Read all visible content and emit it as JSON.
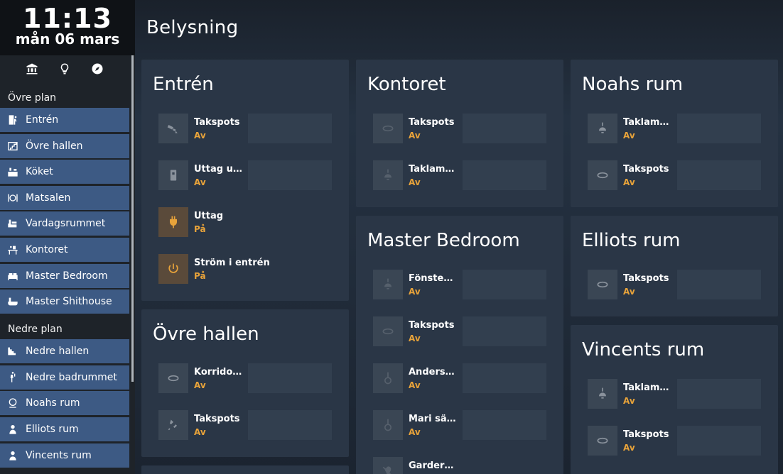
{
  "clock": {
    "time": "11:13",
    "date": "mån 06 mars"
  },
  "quick_icons": [
    "bank-icon",
    "lightbulb-outline-icon",
    "compass-icon"
  ],
  "sidebar": {
    "sections": [
      {
        "label": "Övre plan",
        "items": [
          {
            "label": "Entrén",
            "icon": "door-walk-icon"
          },
          {
            "label": "Övre hallen",
            "icon": "stairs-icon"
          },
          {
            "label": "Köket",
            "icon": "kitchen-icon"
          },
          {
            "label": "Matsalen",
            "icon": "dining-icon"
          },
          {
            "label": "Vardagsrummet",
            "icon": "sofa-icon"
          },
          {
            "label": "Kontoret",
            "icon": "desk-icon"
          },
          {
            "label": "Master Bedroom",
            "icon": "bed-icon"
          },
          {
            "label": "Master Shithouse",
            "icon": "bathtub-icon"
          }
        ]
      },
      {
        "label": "Nedre plan",
        "items": [
          {
            "label": "Nedre hallen",
            "icon": "stairs-down-icon"
          },
          {
            "label": "Nedre badrummet",
            "icon": "shower-icon"
          },
          {
            "label": "Noahs rum",
            "icon": "face-icon"
          },
          {
            "label": "Elliots rum",
            "icon": "child-icon"
          },
          {
            "label": "Vincents rum",
            "icon": "person-icon"
          }
        ]
      }
    ]
  },
  "page_title": "Belysning",
  "cards": [
    {
      "title": "Entrén",
      "entities": [
        {
          "name": "Takspots",
          "state": "Av",
          "icon": "spotlight-icon",
          "on": false
        },
        {
          "name": "Uttag ute",
          "state": "Av",
          "icon": "outlet-icon",
          "on": false
        },
        {
          "name": "Uttag",
          "state": "På",
          "icon": "plug-icon",
          "on": true
        },
        {
          "name": "Ström i entrén",
          "state": "På",
          "icon": "power-icon",
          "on": true
        }
      ]
    },
    {
      "title": "Övre hallen",
      "entities": [
        {
          "name": "Korridoren",
          "state": "Av",
          "icon": "ceiling-light-icon",
          "on": false
        },
        {
          "name": "Takspots",
          "state": "Av",
          "icon": "spotlight-icon",
          "on": false
        }
      ]
    },
    {
      "title": "Kontoret",
      "entities": [
        {
          "name": "Takspots",
          "state": "Av",
          "icon": "ceiling-light-icon",
          "on": false
        },
        {
          "name": "Taklampan",
          "state": "Av",
          "icon": "pendant-lamp-icon",
          "on": false
        }
      ]
    },
    {
      "title": "Master Bedroom",
      "entities": [
        {
          "name": "Fönsterlampan",
          "state": "Av",
          "icon": "pendant-lamp-icon",
          "on": false
        },
        {
          "name": "Takspots",
          "state": "Av",
          "icon": "ceiling-light-icon",
          "on": false
        },
        {
          "name": "Anders lampa",
          "state": "Av",
          "icon": "hanging-bulb-icon",
          "on": false
        },
        {
          "name": "Mari sänglampa",
          "state": "Av",
          "icon": "hanging-bulb-icon",
          "on": false
        },
        {
          "name": "Garderoben",
          "state": "",
          "icon": "lightbulb-off-icon",
          "on": false
        }
      ]
    },
    {
      "title": "Noahs rum",
      "entities": [
        {
          "name": "Taklampan",
          "state": "Av",
          "icon": "pendant-lamp-icon",
          "on": false
        },
        {
          "name": "Takspots",
          "state": "Av",
          "icon": "ceiling-light-icon",
          "on": false
        }
      ]
    },
    {
      "title": "Elliots rum",
      "entities": [
        {
          "name": "Takspots",
          "state": "Av",
          "icon": "ceiling-light-icon",
          "on": false
        }
      ]
    },
    {
      "title": "Vincents rum",
      "entities": [
        {
          "name": "Taklampan",
          "state": "Av",
          "icon": "pendant-lamp-icon",
          "on": false
        },
        {
          "name": "Takspots",
          "state": "Av",
          "icon": "ceiling-light-icon",
          "on": false
        }
      ]
    }
  ],
  "colors": {
    "accent": "#e8a33a",
    "nav": "#3d5a84",
    "card": "#2a3646"
  }
}
